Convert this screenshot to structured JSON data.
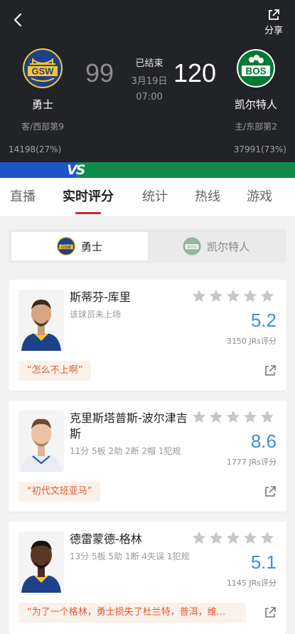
{
  "header": {
    "share_label": "分享",
    "away": {
      "abbr": "GSW",
      "name": "勇士",
      "rank": "客/西部第9",
      "score": "99",
      "support": "14198(27%)",
      "color": "#1d428a",
      "accent": "#ffc72c"
    },
    "home": {
      "abbr": "BOS",
      "name": "凯尔特人",
      "rank": "主/东部第2",
      "score": "120",
      "support": "37991(73%)",
      "color": "#007a33",
      "accent": "#ffffff"
    },
    "status": "已结束",
    "date": "3月19日",
    "time": "07:00"
  },
  "vs_label": "VS",
  "tabs": [
    {
      "label": "直播"
    },
    {
      "label": "实时评分",
      "active": true
    },
    {
      "label": "统计"
    },
    {
      "label": "热线"
    },
    {
      "label": "游戏"
    }
  ],
  "switcher": {
    "away_label": "勇士",
    "home_label": "凯尔特人"
  },
  "players": [
    {
      "name": "斯蒂芬-库里",
      "stats": "该球员未上场",
      "rating": "5.2",
      "count": "3150 JRs评分",
      "comment": "“怎么不上啊”"
    },
    {
      "name": "克里斯塔普斯-波尔津吉斯",
      "stats": "11分 5板 2助 2断 2帽 1犯规",
      "rating": "8.6",
      "count": "1777 JRs评分",
      "comment": "“初代文班亚马”"
    },
    {
      "name": "德雷蒙德-格林",
      "stats": "13分 5板 5助 1断 4失误 1犯规",
      "rating": "5.1",
      "count": "1145 JRs评分",
      "comment": "“为了一个格林，勇士损失了杜兰特，普洱，维..."
    }
  ],
  "colors": {
    "accent_red": "#d6212e",
    "rating_blue": "#3b90d6",
    "comment_orange": "#e05a2c",
    "bar_blue": "#1e55c4",
    "bar_green": "#0f8a4b"
  }
}
